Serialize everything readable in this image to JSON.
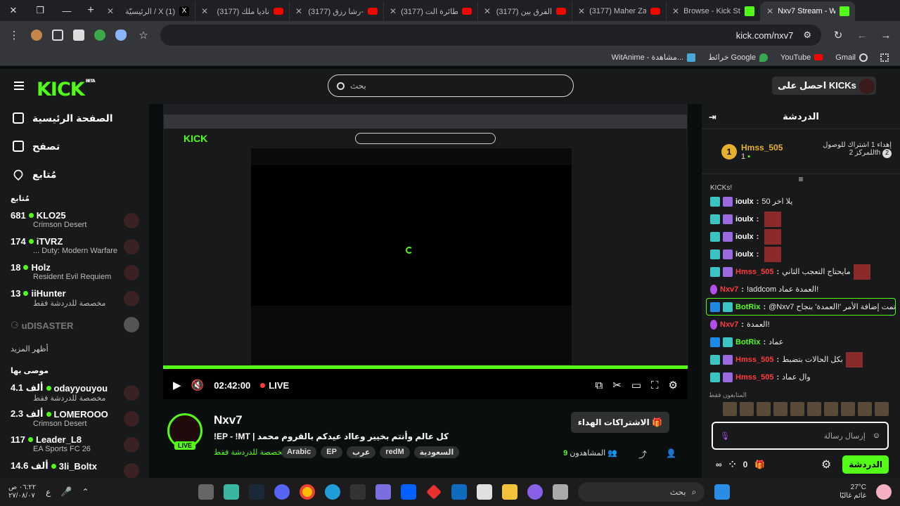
{
  "browser": {
    "tabs": [
      {
        "label": "الرئيسيّة / X (1)",
        "icon": "x"
      },
      {
        "label": "(3177) ناديا ملك",
        "icon": "youtube"
      },
      {
        "label": "(3177) رشا رزق-",
        "icon": "youtube"
      },
      {
        "label": "(3177) الطائرة الت",
        "icon": "youtube"
      },
      {
        "label": "(3177) الفرق بين",
        "icon": "youtube"
      },
      {
        "label": "(3177) Maher Za",
        "icon": "youtube"
      },
      {
        "label": "Browse - Kick Str",
        "icon": "kick"
      },
      {
        "label": "Nxv7 Stream - W",
        "icon": "kick"
      }
    ],
    "url": "kick.com/nxv7",
    "bookmarks": [
      "WitAnime - مشاهدة...",
      "خرائط Google",
      "YouTube",
      "Gmail"
    ]
  },
  "header": {
    "logo": "KICK",
    "beta": "BETA",
    "search_placeholder": "بحث",
    "get_kicks": "احصل على KICKs"
  },
  "sidebar": {
    "nav": [
      "الصفحة الرئيسية",
      "تصفح",
      "مُتابع"
    ],
    "following_title": "مُتابع",
    "following": [
      {
        "viewers": "681",
        "name": "KLO25",
        "game": "Crimson Desert"
      },
      {
        "viewers": "174",
        "name": "iTVRZ",
        "game": "... Duty: Modern Warfare"
      },
      {
        "viewers": "18",
        "name": "Holz",
        "game": "Resident Evil Requiem"
      },
      {
        "viewers": "13",
        "name": "iiHunter",
        "game": "مخصصة للدردشة فقط"
      }
    ],
    "offline": "uDISASTER",
    "show_more": "أظهر المزيد",
    "recommended_title": "موصى بها",
    "recommended": [
      {
        "viewers": "4.1 ألف",
        "name": "odayyouyou",
        "game": "مخصصة للدردشة فقط"
      },
      {
        "viewers": "2.3 ألف",
        "name": "LOMEROOO",
        "game": "Crimson Desert"
      },
      {
        "viewers": "117",
        "name": "Leader_L8",
        "game": "EA Sports FC 26"
      },
      {
        "viewers": "14.6 ألف",
        "name": "3li_Boltx",
        "game": ""
      }
    ]
  },
  "player": {
    "time": "02:42:00",
    "live": "LIVE"
  },
  "stream": {
    "name": "Nxv7",
    "live": "LIVE",
    "title": "!EP - !MT | كل عالم وأنتم بخيير وعااد عيدكم بالقروم محمد",
    "category": "مخصصة للدردشة فقط",
    "tags": [
      "السعودية",
      "redM",
      "عرب",
      "EP",
      "Arabic"
    ],
    "sub_button": "الاشتراكات الهداء",
    "viewers_label": "المشاهدون",
    "viewers": "9"
  },
  "chat": {
    "title": "الدردشة",
    "pinned": {
      "rank": "1",
      "name": "Hmss_505",
      "count": "1",
      "right_text": "إهداء 1 اشتراك للوصول للمركز 2th",
      "right_num": "2"
    },
    "kicks_label": "KICKs!",
    "messages": [
      {
        "user": "ioulx",
        "text": "يلا اخر 50",
        "color": "#ffffff"
      },
      {
        "user": "ioulx",
        "text": "",
        "color": "#ffffff"
      },
      {
        "user": "ioulx",
        "text": "",
        "color": "#ffffff"
      },
      {
        "user": "ioulx",
        "text": "",
        "color": "#ffffff"
      },
      {
        "user": "Hmss_505",
        "text": "مايحتاج التعجب الثاني",
        "color": "#ff3b3b"
      },
      {
        "user": "Nxv7",
        "text": "!addcom العمدة عماد!",
        "color": "#ff3b3b"
      },
      {
        "user": "BotRix",
        "text": "@Nxv7 تمت إضافة الأمر '!العمدة' بنجاح.",
        "color": "#53fc18"
      },
      {
        "user": "Nxv7",
        "text": "العمدة!",
        "color": "#ff3b3b"
      },
      {
        "user": "BotRix",
        "text": "عماد",
        "color": "#53fc18"
      },
      {
        "user": "Hmss_505",
        "text": "بكل الحالات بتضبط",
        "color": "#ff3b3b"
      },
      {
        "user": "Hmss_505",
        "text": "وال عماد",
        "color": "#ff3b3b"
      }
    ],
    "emote_label": "المتابعون فقط",
    "input_placeholder": "إرسال رسالة",
    "count": "0",
    "chat_button": "الدردشة"
  },
  "taskbar": {
    "time": "٠٦:٢٢ ص",
    "date": "٢٧/٠٨/٠٧",
    "lang": "ع",
    "search": "بحث",
    "weather_temp": "27°C",
    "weather_text": "غائم غالبًا"
  }
}
